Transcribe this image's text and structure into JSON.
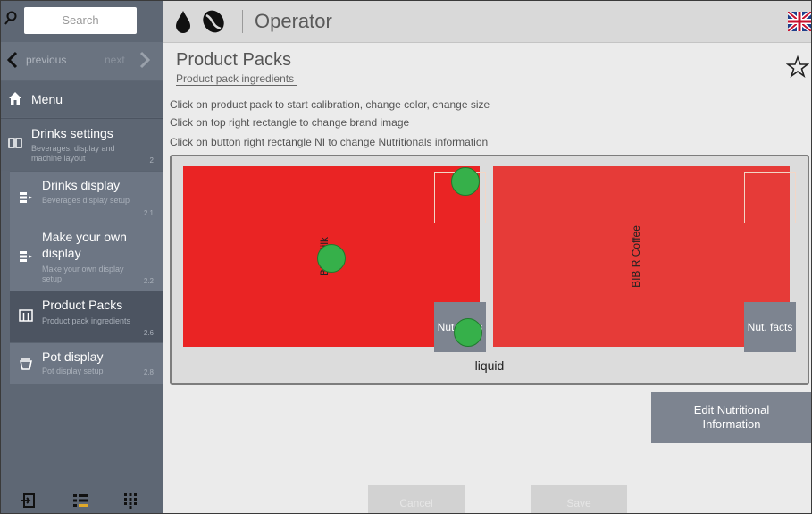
{
  "sidebar": {
    "search_placeholder": "Search",
    "nav": {
      "previous": "previous",
      "next": "next"
    },
    "menu_label": "Menu",
    "section": {
      "title": "Drinks settings",
      "subtitle": "Beverages, display and machine layout",
      "number": "2"
    },
    "items": [
      {
        "title": "Drinks display",
        "subtitle": "Beverages display setup",
        "number": "2.1"
      },
      {
        "title": "Make your own display",
        "subtitle": "Make your own display setup",
        "number": "2.2"
      },
      {
        "title": "Product Packs",
        "subtitle": "Product pack ingredients",
        "number": "2.6"
      },
      {
        "title": "Pot display",
        "subtitle": "Pot display setup",
        "number": "2.8"
      }
    ]
  },
  "header": {
    "title": "Operator"
  },
  "main": {
    "title": "Product Packs",
    "subtitle": "Product pack ingredients",
    "instructions": [
      "Click on product pack to start calibration, change color, change size",
      "Click on top right rectangle to change brand image",
      "Click on button right rectangle NI to change Nutritionals information"
    ],
    "packs": [
      {
        "label": "BIB Milk",
        "nut_label": "Nut. facts",
        "color": "#ea2424"
      },
      {
        "label": "BIB R Coffee",
        "nut_label": "Nut. facts",
        "color": "#e63b38"
      }
    ],
    "group_label": "liquid",
    "edit_button": "Edit Nutritional Information",
    "cancel_button": "Cancel",
    "save_button": "Save"
  },
  "icons": {
    "search": "search-icon",
    "previous": "chevron-left-icon",
    "next": "chevron-right-icon",
    "menu": "home-icon",
    "drop": "water-drop-icon",
    "bean": "coffee-bean-icon",
    "flag": "uk-flag-icon",
    "star": "star-icon"
  }
}
